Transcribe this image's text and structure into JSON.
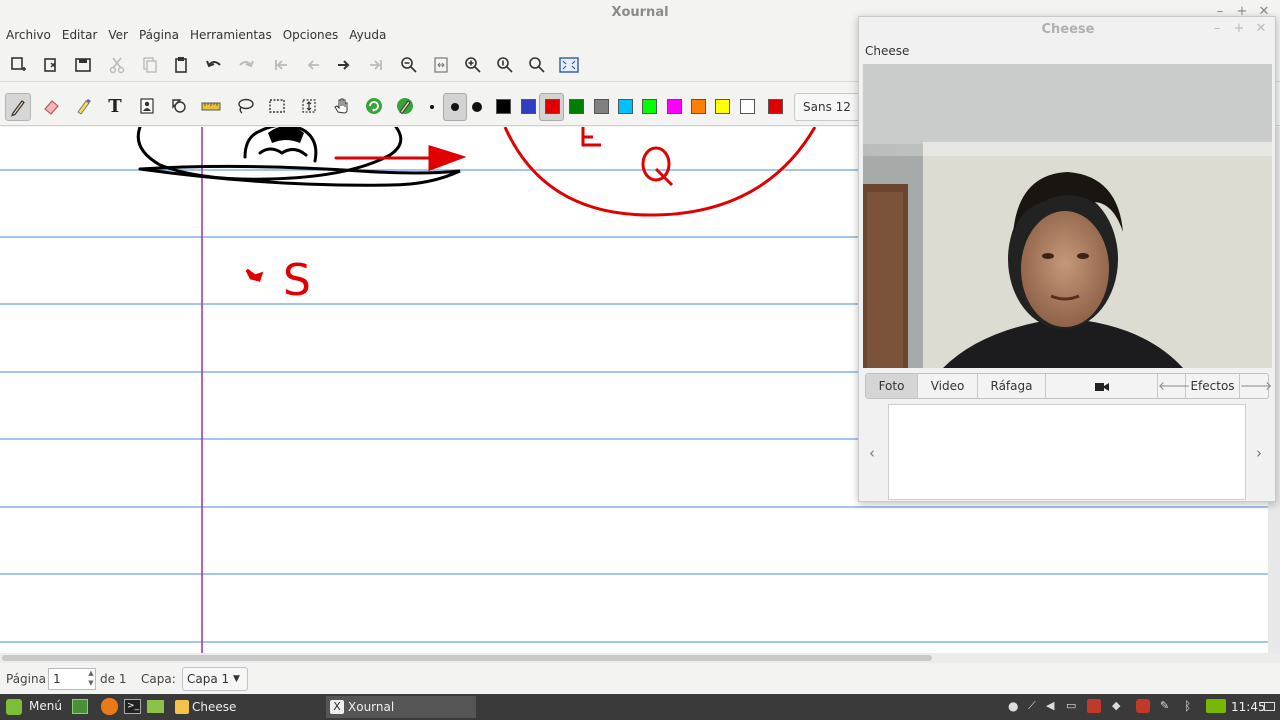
{
  "xournal": {
    "title": "Xournal",
    "menu": [
      "Archivo",
      "Editar",
      "Ver",
      "Página",
      "Herramientas",
      "Opciones",
      "Ayuda"
    ],
    "font_button": "Sans 12",
    "colors": [
      "#000000",
      "#2f3fbf",
      "#e00000",
      "#008000",
      "#808080",
      "#00c0ff",
      "#00ff00",
      "#ff00ff",
      "#ff8000",
      "#ffff00",
      "#ffffff",
      "#e00000"
    ],
    "selected_color_index": 2,
    "canvas_text": "S"
  },
  "status": {
    "page_label": "Página",
    "page_value": "1",
    "of_label": "de 1",
    "layer_label": "Capa:",
    "layer_value": "Capa 1"
  },
  "cheese": {
    "title": "Cheese",
    "subtitle": "Cheese",
    "tabs": [
      "Foto",
      "Video",
      "Ráfaga"
    ],
    "effects_label": "Efectos"
  },
  "taskbar": {
    "menu_label": "Menú",
    "tasks": [
      "Cheese",
      "Xournal"
    ],
    "clock": "11:45"
  }
}
